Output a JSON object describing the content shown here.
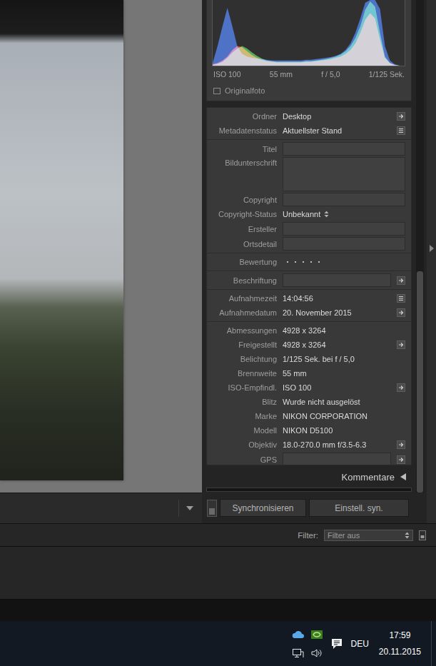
{
  "histogram": {
    "series": [
      {
        "name": "red",
        "color": "#d23a32",
        "values": [
          2,
          4,
          8,
          14,
          24,
          30,
          28,
          22,
          16,
          12,
          9,
          7,
          6,
          5,
          5,
          5,
          5,
          5,
          5,
          6,
          6,
          7,
          8,
          9,
          10,
          12,
          14,
          18,
          24,
          34,
          50,
          70,
          80,
          72,
          40,
          12,
          4,
          1,
          0,
          0
        ]
      },
      {
        "name": "green",
        "color": "#3bb23b",
        "values": [
          1,
          3,
          6,
          12,
          20,
          26,
          30,
          26,
          20,
          15,
          11,
          8,
          7,
          6,
          6,
          6,
          6,
          6,
          6,
          7,
          7,
          8,
          9,
          10,
          12,
          14,
          17,
          22,
          30,
          42,
          60,
          85,
          98,
          90,
          50,
          14,
          4,
          1,
          0,
          0
        ]
      },
      {
        "name": "blue",
        "color": "#2b5fd8",
        "values": [
          4,
          30,
          60,
          88,
          60,
          30,
          18,
          14,
          12,
          11,
          10,
          9,
          8,
          8,
          8,
          8,
          8,
          8,
          8,
          9,
          9,
          10,
          11,
          12,
          13,
          15,
          18,
          24,
          34,
          50,
          72,
          96,
          100,
          110,
          86,
          30,
          8,
          2,
          0,
          0
        ]
      }
    ],
    "info": [
      "ISO 100",
      "55 mm",
      "f / 5,0",
      "1/125 Sek."
    ],
    "original": {
      "label": "Originalfoto",
      "checked": false
    }
  },
  "metadata": {
    "groups": [
      {
        "rows": [
          {
            "label": "Ordner",
            "kind": "text",
            "value": "Desktop",
            "button": "arrow"
          },
          {
            "label": "Metadatenstatus",
            "kind": "text",
            "value": "Aktuellster Stand",
            "button": "list"
          }
        ]
      },
      {
        "rows": [
          {
            "label": "Titel",
            "kind": "field",
            "value": "",
            "button": null
          },
          {
            "label": "Bildunterschrift",
            "kind": "textarea",
            "value": "",
            "button": null
          },
          {
            "label": "Copyright",
            "kind": "field",
            "value": "",
            "button": null
          },
          {
            "label": "Copyright-Status",
            "kind": "dropdown",
            "value": "Unbekannt",
            "button": null
          },
          {
            "label": "Ersteller",
            "kind": "field",
            "value": "",
            "button": null
          },
          {
            "label": "Ortsdetail",
            "kind": "field",
            "value": "",
            "button": null
          }
        ]
      },
      {
        "rows": [
          {
            "label": "Bewertung",
            "kind": "rating",
            "stars": 0,
            "out_of": 5,
            "button": null
          }
        ]
      },
      {
        "rows": [
          {
            "label": "Beschriftung",
            "kind": "field",
            "value": "",
            "button": "arrow"
          }
        ]
      },
      {
        "rows": [
          {
            "label": "Aufnahmezeit",
            "kind": "text",
            "value": "14:04:56",
            "button": "list"
          },
          {
            "label": "Aufnahmedatum",
            "kind": "text",
            "value": "20. November 2015",
            "button": "arrow"
          }
        ]
      },
      {
        "rows": [
          {
            "label": "Abmessungen",
            "kind": "text",
            "value": "4928 x 3264",
            "button": null
          },
          {
            "label": "Freigestellt",
            "kind": "text",
            "value": "4928 x 3264",
            "button": "arrow"
          },
          {
            "label": "Belichtung",
            "kind": "text",
            "value": "1/125 Sek. bei f / 5,0",
            "button": null
          },
          {
            "label": "Brennweite",
            "kind": "text",
            "value": "55 mm",
            "button": null
          },
          {
            "label": "ISO-Empfindl.",
            "kind": "text",
            "value": "ISO 100",
            "button": "arrow"
          },
          {
            "label": "Blitz",
            "kind": "text",
            "value": "Wurde nicht ausgelöst",
            "button": null
          },
          {
            "label": "Marke",
            "kind": "text",
            "value": "NIKON CORPORATION",
            "button": null
          },
          {
            "label": "Modell",
            "kind": "text",
            "value": "NIKON D5100",
            "button": null
          },
          {
            "label": "Objektiv",
            "kind": "text",
            "value": "18.0-270.0 mm f/3.5-6.3",
            "button": "arrow"
          },
          {
            "label": "GPS",
            "kind": "field",
            "value": "",
            "button": "arrow"
          }
        ]
      }
    ]
  },
  "comments": {
    "label": "Kommentare",
    "expanded": false
  },
  "scrollbar": {
    "start": 0.55,
    "size": 0.45
  },
  "sync": {
    "toggle_on": false,
    "buttons": [
      "Synchronisieren",
      "Einstell. syn."
    ]
  },
  "filter": {
    "label": "Filter:",
    "value": "Filter aus"
  },
  "taskbar": {
    "language": "DEU",
    "time": "17:59",
    "date": "20.11.2015"
  }
}
